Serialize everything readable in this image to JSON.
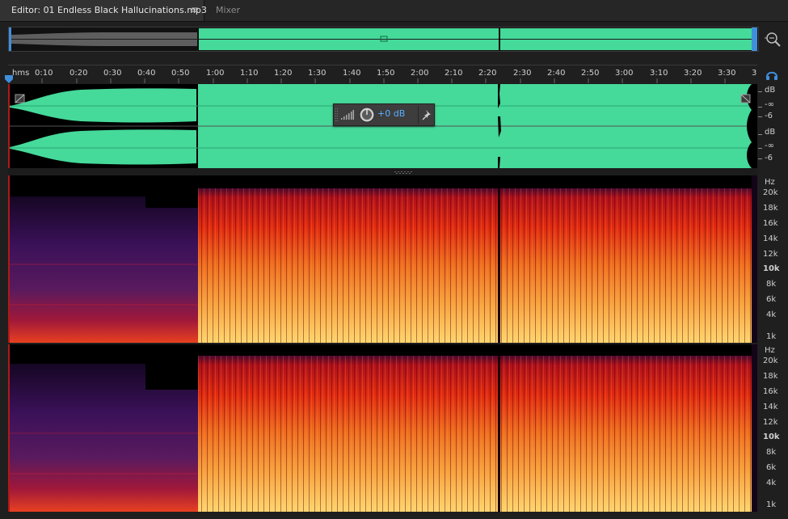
{
  "tabs": {
    "editor_label": "Editor: 01 Endless Black Hallucinations.mp3",
    "editor_menu_glyph": "≡",
    "mixer_label": "Mixer"
  },
  "ruler": {
    "unit": "hms",
    "ticks": [
      "0:10",
      "0:20",
      "0:30",
      "0:40",
      "0:50",
      "1:00",
      "1:10",
      "1:20",
      "1:30",
      "1:40",
      "1:50",
      "2:00",
      "2:10",
      "2:20",
      "2:30",
      "2:40",
      "2:50",
      "3:00",
      "3:10",
      "3:20",
      "3:30",
      "3"
    ]
  },
  "waveform": {
    "scale_top": [
      "dB",
      "-∞",
      "-6"
    ],
    "scale_bottom": [
      "dB",
      "-∞",
      "-6"
    ]
  },
  "hud": {
    "value": "+0 dB",
    "icons": [
      "level-meter-icon",
      "volume-knob-icon",
      "pin-icon"
    ]
  },
  "spectral": {
    "unit": "Hz",
    "labels": [
      "20k",
      "18k",
      "16k",
      "14k",
      "12k",
      "10k",
      "8k",
      "6k",
      "4k",
      "1k"
    ]
  },
  "icons": {
    "zoom": "zoom-icon",
    "headphones": "headphones-icon",
    "playhead": "playhead-marker-icon"
  },
  "colors": {
    "waveform": "#45d99a",
    "waveform_bg": "#000000",
    "accent_blue": "#3f8fdc",
    "spectro_low": "#2a0a3c",
    "spectro_mid": "#d01010",
    "spectro_high": "#ffd060"
  }
}
